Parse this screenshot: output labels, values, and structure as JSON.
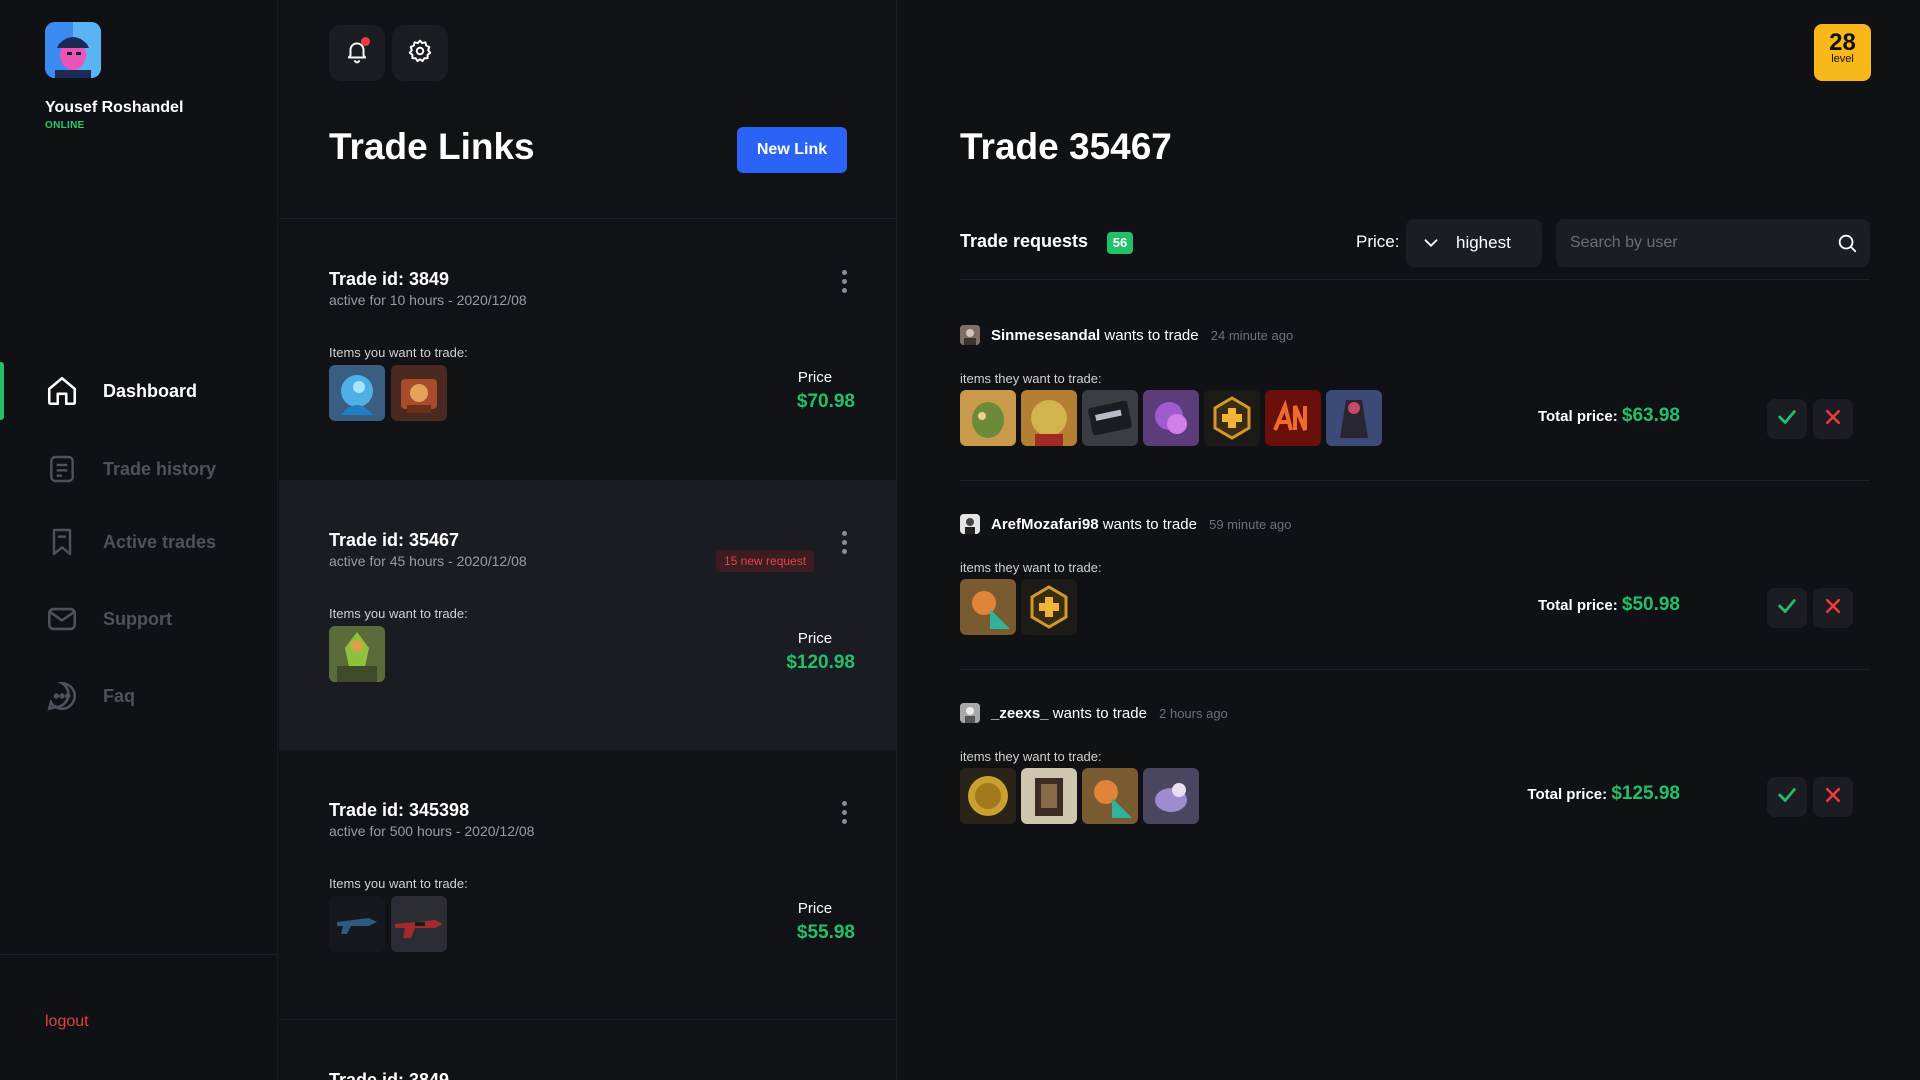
{
  "sidebar": {
    "user": {
      "name": "Yousef Roshandel",
      "status": "ONLINE"
    },
    "nav": [
      {
        "label": "Dashboard",
        "icon": "home-icon",
        "active": true
      },
      {
        "label": "Trade history",
        "icon": "document-icon",
        "active": false
      },
      {
        "label": "Active trades",
        "icon": "bookmark-icon",
        "active": false
      },
      {
        "label": "Support",
        "icon": "mail-icon",
        "active": false
      },
      {
        "label": "Faq",
        "icon": "chat-icon",
        "active": false
      }
    ],
    "logout": "logout"
  },
  "trade_links": {
    "title": "Trade Links",
    "new_link": "New Link",
    "cards": [
      {
        "id": "Trade id: 3849",
        "active": "active for 10 hours - 2020/12/08",
        "items_label": "Items you want to trade:",
        "price_label": "Price",
        "price": "$70.98",
        "badge": ""
      },
      {
        "id": "Trade id: 35467",
        "active": "active for 45 hours - 2020/12/08",
        "items_label": "Items you want to trade:",
        "price_label": "Price",
        "price": "$120.98",
        "badge": "15 new request"
      },
      {
        "id": "Trade id: 345398",
        "active": "active for 500 hours - 2020/12/08",
        "items_label": "Items you want to trade:",
        "price_label": "Price",
        "price": "$55.98",
        "badge": ""
      }
    ],
    "partial_card_id": "Trade id: 3849"
  },
  "trade": {
    "level": "28",
    "level_label": "level",
    "title": "Trade 35467",
    "requests_label": "Trade requests",
    "requests_count": "56",
    "price_filter_label": "Price:",
    "price_filter_value": "highest",
    "search_placeholder": "Search by user",
    "requests": [
      {
        "user": "Sinmesesandal",
        "action": "wants to trade",
        "time": "24 minute ago",
        "items_label": "items they want to trade:",
        "total_label": "Total price:",
        "total": "$63.98"
      },
      {
        "user": "ArefMozafari98",
        "action": "wants to trade",
        "time": "59 minute ago",
        "items_label": "items they want to trade:",
        "total_label": "Total price:",
        "total": "$50.98"
      },
      {
        "user": "_zeexs_",
        "action": "wants to trade",
        "time": "2 hours ago",
        "items_label": "items they want to trade:",
        "total_label": "Total price:",
        "total": "$125.98"
      }
    ]
  },
  "colors": {
    "accent_green": "#22c06a",
    "accent_blue": "#2a63f5",
    "level_yellow": "#f6b919",
    "danger_red": "#e0423b"
  }
}
